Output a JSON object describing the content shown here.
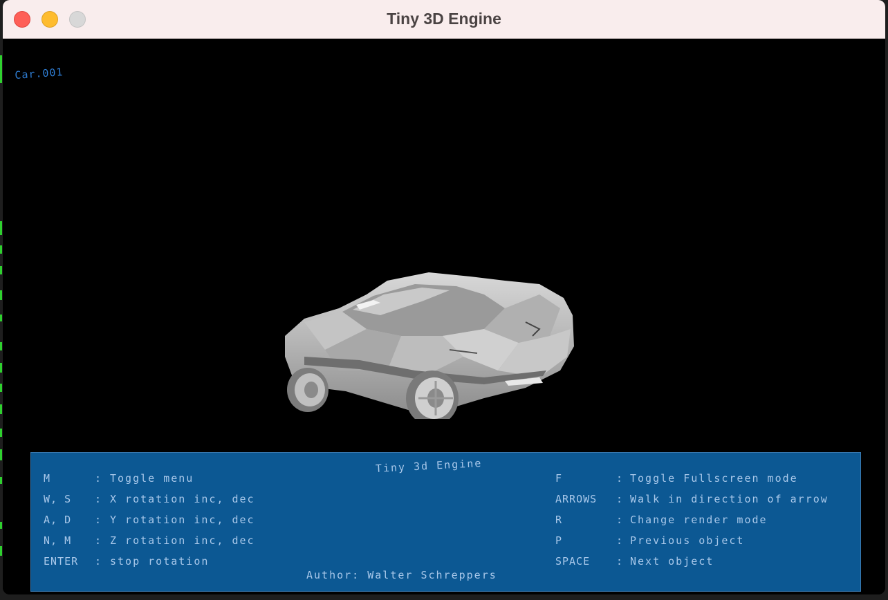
{
  "window": {
    "title": "Tiny 3D Engine"
  },
  "viewport": {
    "object_label": "Car.001"
  },
  "menu": {
    "title": "Tiny 3d Engine",
    "author": "Author: Walter Schreppers",
    "left_items": [
      {
        "key": "M",
        "desc": "Toggle menu"
      },
      {
        "key": "W, S",
        "desc": "X rotation inc, dec"
      },
      {
        "key": "A, D",
        "desc": "Y rotation inc, dec"
      },
      {
        "key": "N, M",
        "desc": "Z rotation inc, dec"
      },
      {
        "key": "ENTER",
        "desc": "stop rotation"
      }
    ],
    "right_items": [
      {
        "key": "F",
        "desc": "Toggle Fullscreen mode"
      },
      {
        "key": "ARROWS",
        "desc": "Walk in direction of arrow"
      },
      {
        "key": "R",
        "desc": "Change render mode"
      },
      {
        "key": "P",
        "desc": "Previous object"
      },
      {
        "key": "SPACE",
        "desc": "Next object"
      }
    ],
    "separator": ":"
  },
  "colors": {
    "menu_bg": "#0c5893",
    "menu_text": "#a9c8ea",
    "label_blue": "#2f7fd6",
    "titlebar_bg": "#f9eded"
  }
}
